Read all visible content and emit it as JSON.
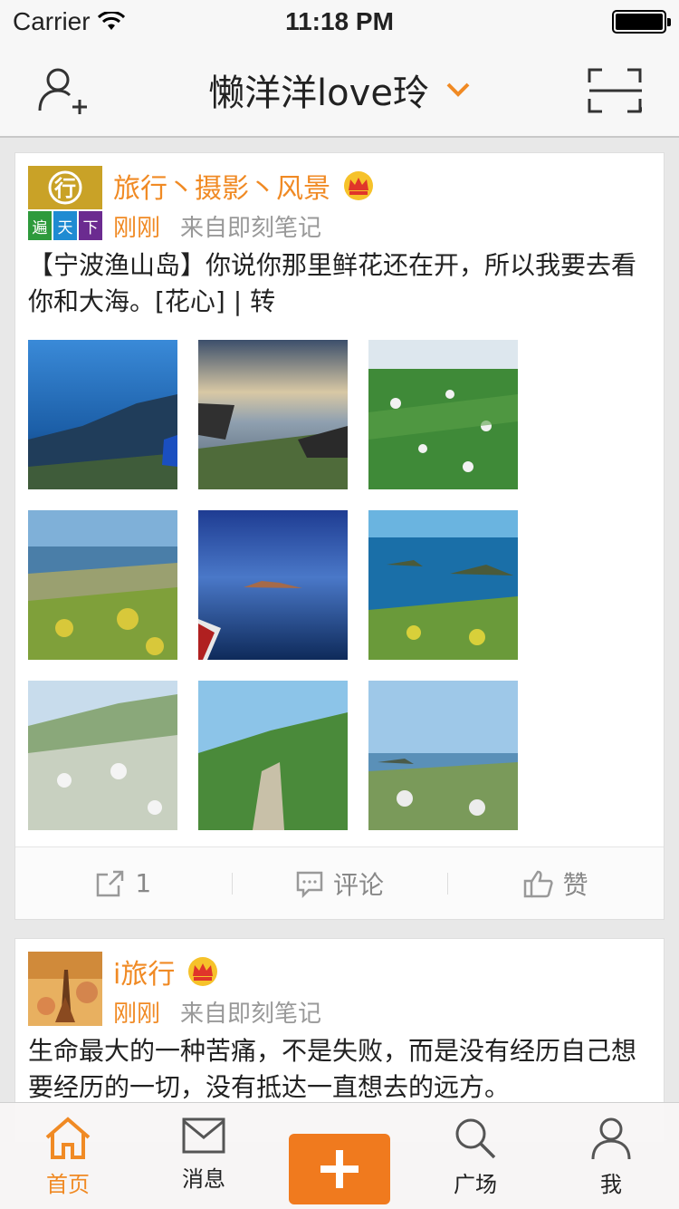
{
  "status": {
    "carrier": "Carrier",
    "time": "11:18 PM"
  },
  "nav": {
    "title": "懒洋洋love玲"
  },
  "posts": [
    {
      "username": "旅行丶摄影丶风景",
      "time": "刚刚",
      "source": "来自即刻笔记",
      "text": "【宁波渔山岛】你说你那里鲜花还在开，所以我要去看你和大海。[花心] | 转",
      "avatar_text": [
        "行",
        "遍",
        "天",
        "下"
      ],
      "actions": {
        "repost": "1",
        "comment": "评论",
        "like": "赞"
      }
    },
    {
      "username": "i旅行",
      "time": "刚刚",
      "source": "来自即刻笔记",
      "text": "生命最大的一种苦痛，不是失败，而是没有经历自己想要经历的一切，没有抵达一直想去的远方。"
    }
  ],
  "tabs": {
    "home": "首页",
    "messages": "消息",
    "discover": "广场",
    "me": "我"
  },
  "colors": {
    "accent": "#f08a24",
    "plus": "#f07a1e"
  }
}
